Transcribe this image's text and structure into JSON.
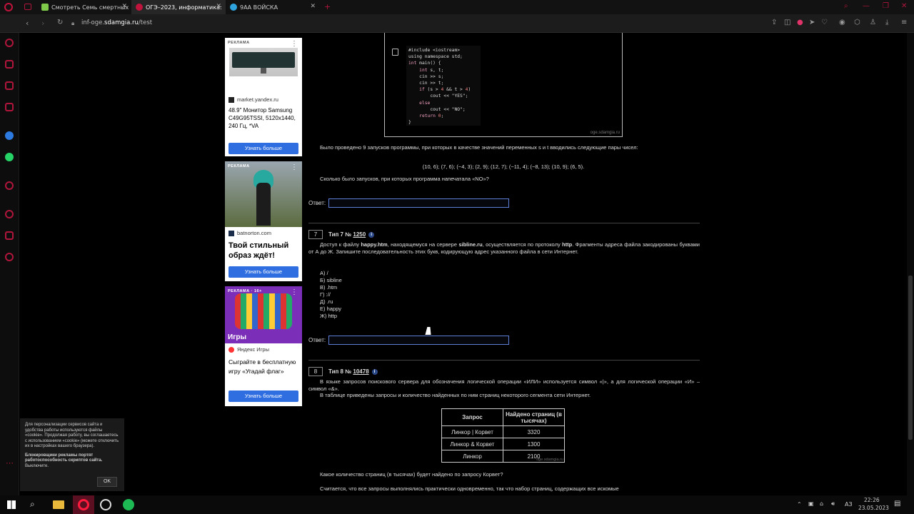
{
  "browser": {
    "tabs": [
      {
        "label": "Смотреть Семь смертных",
        "active": false
      },
      {
        "label": "ОГЭ–2023, информатика:",
        "active": true
      },
      {
        "label": "9АА ВОЙСКА",
        "active": false
      }
    ],
    "url_prefix": "inf-oge.",
    "url_domain": "sdamgia.ru",
    "url_path": "/test"
  },
  "ads": [
    {
      "label": "РЕКЛАМА",
      "source": "market.yandex.ru",
      "title": "48.9\" Монитор Samsung C49G95TSSI, 5120x1440, 240 Гц, *VA",
      "button": "Узнать больше"
    },
    {
      "label": "РЕКЛАМА",
      "source": "batnorton.com",
      "title": "Твой стильный образ ждёт!",
      "button": "Узнать больше"
    },
    {
      "label": "РЕКЛАМА · 16+",
      "banner": "Игры",
      "source": "Яндекс Игры",
      "title": "Сыграйте в бесплатную игру «Угадай флаг»",
      "button": "Узнать больше"
    }
  ],
  "code": {
    "watermark": "oge.sdamgia.ru"
  },
  "q6": {
    "text": "Было проведено 9 запусков программы, при которых в качестве значений переменных s и t вводились следующие пары чисел:",
    "pairs": "(10, 6); (7, 6); (−4, 3); (2, 9); (12, 7); (−11, 4); (−8, 13); (10, 9); (6, 5).",
    "question": "Сколько было запусков, при которых программа напечатала «NO»?",
    "answer_label": "Ответ:"
  },
  "q7": {
    "number": "7",
    "type_label": "Тип 7 №",
    "id": "1250",
    "text_a": "Доступ к файлу",
    "file": "happy.htm",
    "text_b": ", находящемуся на сервере",
    "server": "sibline.ru",
    "text_c": ", осуществляется по протоколу",
    "protocol": "http",
    "text_d": ". Фрагменты адреса файла закодированы буквами от А до Ж. Запишите последовательность этих букв, кодирующую адрес указанного файла в сети Интернет.",
    "options": [
      "А) /",
      "Б) sibline",
      "В) .htm",
      "Г) ://",
      "Д) .ru",
      "Е) happy",
      "Ж) http"
    ],
    "answer_label": "Ответ:"
  },
  "q8": {
    "number": "8",
    "type_label": "Тип 8 №",
    "id": "10478",
    "text1": "В языке запросов поискового сервера для обозначения логической операции «ИЛИ» используется символ «|», а для логической операции «И» – символ «&».",
    "text2": "В таблице приведены запросы и количество найденных по ним страниц некоторого сегмента сети Интернет.",
    "table_headers": [
      "Запрос",
      "Найдено страниц (в тысячах)"
    ],
    "table_rows": [
      [
        "Линкор | Корвет",
        "3320"
      ],
      [
        "Линкор & Корвет",
        "1300"
      ],
      [
        "Линкор",
        "2100"
      ]
    ],
    "table_watermark": "oge.sdamgia.ru",
    "question": "Какое количество страниц (в тысячах) будет найдено по запросу Корвет?",
    "footer": "Считается, что все запросы выполнялись практически одновременно, так что набор страниц, содержащих все искомые"
  },
  "cookie": {
    "text": "Для персонализации сервисов сайта и удобства работы используются файлы «cookie». Продолжая работу, вы соглашаетесь с использованием «cookie» (можете отключить их в настройках вашего браузера).",
    "bold": "Блокировщики рекламы портят работоспособность скриптов сайта.",
    "off": "Выключите.",
    "ok": "OK"
  },
  "taskbar": {
    "lang": "АЗ",
    "time": "22:26",
    "date": "23.05.2023"
  }
}
